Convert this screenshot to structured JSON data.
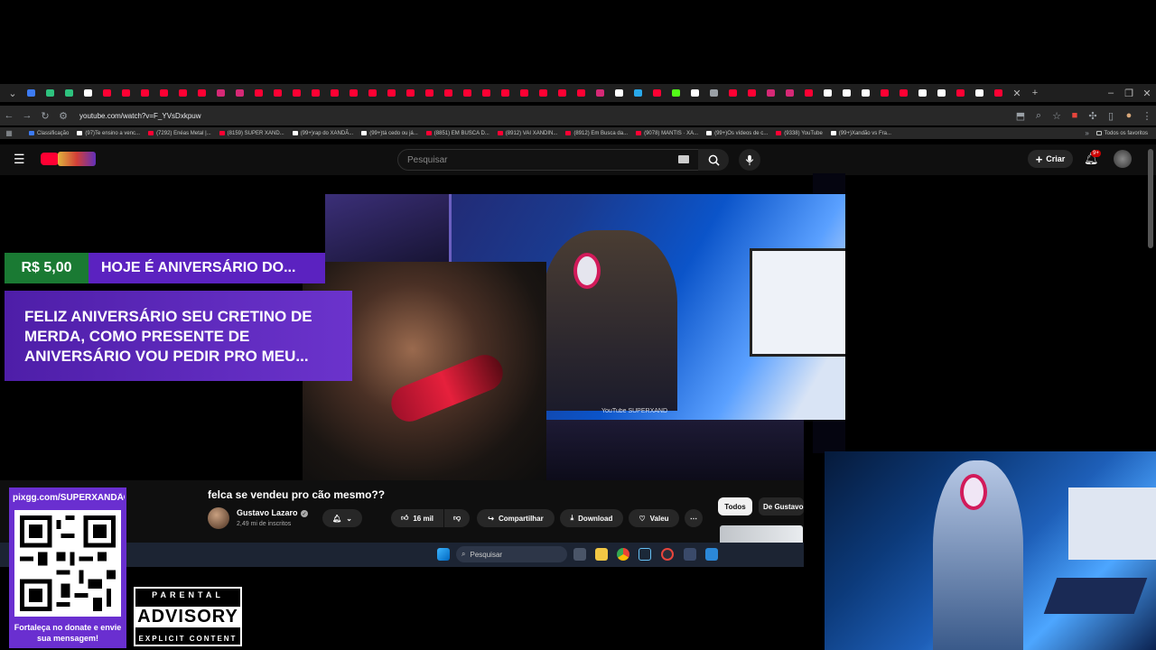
{
  "browser": {
    "url": "youtube.com/watch?v=F_YVsDxkpuw",
    "tab_favicon_colors": [
      "#3c7bf4",
      "#2ec27e",
      "#2ec27e",
      "#ffffff",
      "#ff0033",
      "#ff0033",
      "#ff0033",
      "#ff0033",
      "#ff0033",
      "#ff0033",
      "#d62976",
      "#d62976",
      "#ff0033",
      "#ff0033",
      "#ff0033",
      "#ff0033",
      "#ff0033",
      "#ff0033",
      "#ff0033",
      "#ff0033",
      "#ff0033",
      "#ff0033",
      "#ff0033",
      "#ff0033",
      "#ff0033",
      "#ff0033",
      "#ff0033",
      "#ff0033",
      "#ff0033",
      "#ff0033",
      "#d62976",
      "#ffffff",
      "#29a9eb",
      "#ff0033",
      "#53fc18",
      "#ffffff",
      "#9aa0a6",
      "#ff0033",
      "#ff0033",
      "#d62976",
      "#d62976",
      "#ff0033",
      "#ffffff",
      "#ffffff",
      "#ffffff",
      "#ff0033",
      "#ff0033",
      "#ffffff",
      "#ffffff",
      "#ff0033",
      "#ffffff",
      "#ff0033"
    ],
    "bookmarks": [
      {
        "label": "Classificação",
        "color": "#3c7bf4"
      },
      {
        "label": "(97)Te ensino a venc...",
        "color": "#ffffff"
      },
      {
        "label": "(7292) Enéas Metal |...",
        "color": "#ff0033"
      },
      {
        "label": "(8159) SUPER XAND...",
        "color": "#ff0033"
      },
      {
        "label": "(99+)rap do XANDÃ...",
        "color": "#ffffff"
      },
      {
        "label": "(99+)tá cedo ou já...",
        "color": "#ffffff"
      },
      {
        "label": "(8851) EM BUSCA D...",
        "color": "#ff0033"
      },
      {
        "label": "(8912) VAI XANDIN...",
        "color": "#ff0033"
      },
      {
        "label": "(8912) Em Busca da...",
        "color": "#ff0033"
      },
      {
        "label": "(9078) MANTIS · XA...",
        "color": "#ff0033"
      },
      {
        "label": "(99+)Os vídeos de c...",
        "color": "#ffffff"
      },
      {
        "label": "(9338) YouTube",
        "color": "#ff0033"
      },
      {
        "label": "(99+)Xandão vs Fra...",
        "color": "#ffffff"
      }
    ],
    "all_bookmarks_label": "Todos os favoritos"
  },
  "youtube": {
    "search_placeholder": "Pesquisar",
    "create_label": "Criar",
    "notif_badge": "9+"
  },
  "donation": {
    "amount": "R$ 5,00",
    "title": "HOJE É ANIVERSÁRIO DO...",
    "message": "FELIZ ANIVERSÁRIO SEU CRETINO DE MERDA, COMO PRESENTE DE ANIVERSÁRIO VOU PEDIR PRO MEU..."
  },
  "video": {
    "title": "felca se vendeu pro cão mesmo??",
    "channel": "Gustavo Lazaro",
    "subscribers": "2,49 mi de inscritos",
    "likes": "16 mil",
    "share_label": "Compartilhar",
    "download_label": "Download",
    "thanks_label": "Valeu",
    "filters": [
      "Todos",
      "De Gustavo"
    ],
    "watermark": "YouTube SUPERXAND"
  },
  "taskbar": {
    "search_placeholder": "Pesquisar"
  },
  "overlay": {
    "qr_url": "pixgg.com/SUPERXANDÃO",
    "qr_caption": "Fortaleça no donate e envie sua mensagem!",
    "advisory_top": "PARENTAL",
    "advisory_main": "ADVISORY",
    "advisory_bottom": "EXPLICIT CONTENT"
  }
}
